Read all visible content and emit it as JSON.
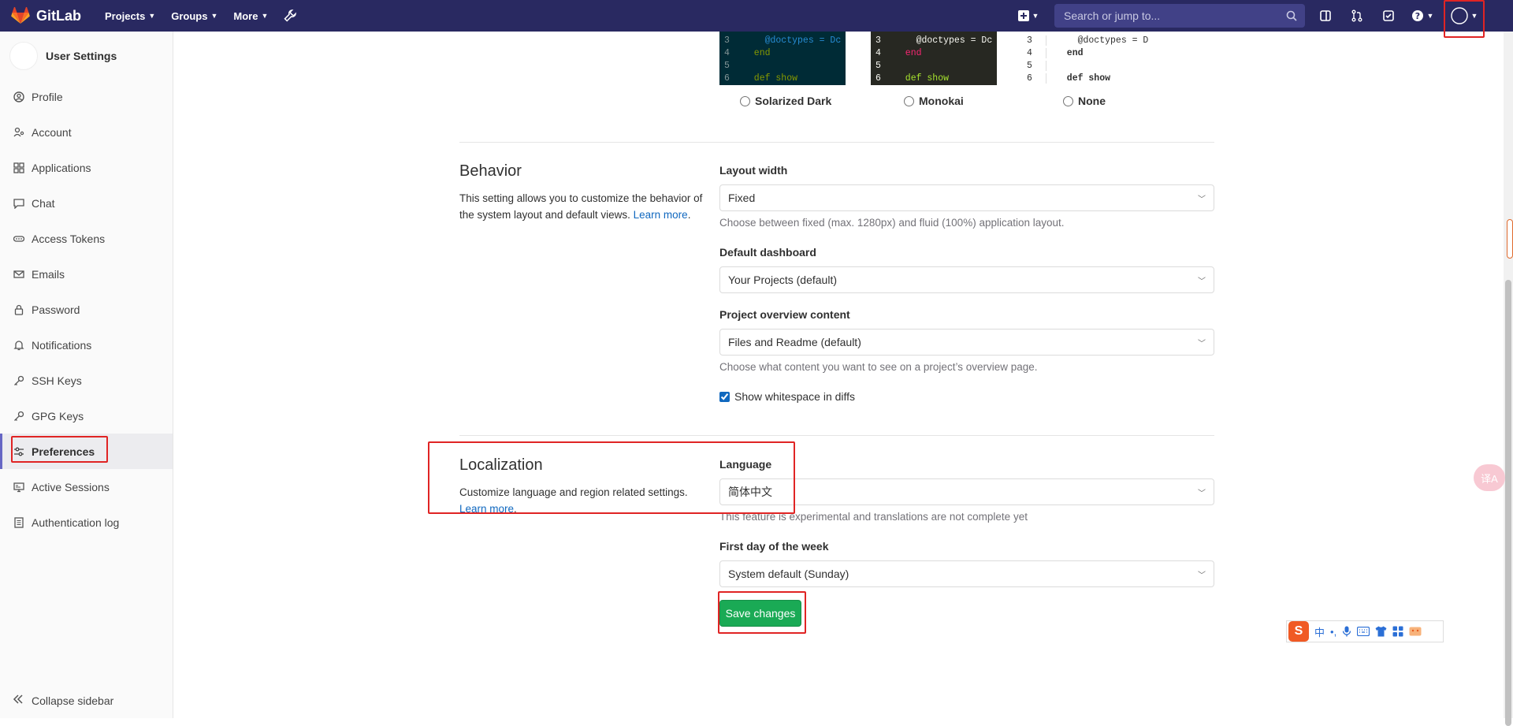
{
  "navbar": {
    "brand": "GitLab",
    "menu": [
      {
        "label": "Projects"
      },
      {
        "label": "Groups"
      },
      {
        "label": "More"
      }
    ],
    "search_placeholder": "Search or jump to..."
  },
  "sidebar": {
    "title": "User Settings",
    "items": [
      {
        "label": "Profile",
        "icon": "profile-icon"
      },
      {
        "label": "Account",
        "icon": "account-icon"
      },
      {
        "label": "Applications",
        "icon": "applications-icon"
      },
      {
        "label": "Chat",
        "icon": "chat-icon"
      },
      {
        "label": "Access Tokens",
        "icon": "token-icon"
      },
      {
        "label": "Emails",
        "icon": "email-icon"
      },
      {
        "label": "Password",
        "icon": "lock-icon"
      },
      {
        "label": "Notifications",
        "icon": "bell-icon"
      },
      {
        "label": "SSH Keys",
        "icon": "key-icon"
      },
      {
        "label": "GPG Keys",
        "icon": "key-icon"
      },
      {
        "label": "Preferences",
        "icon": "preferences-icon",
        "active": true
      },
      {
        "label": "Active Sessions",
        "icon": "monitor-icon"
      },
      {
        "label": "Authentication log",
        "icon": "log-icon"
      }
    ],
    "collapse_label": "Collapse sidebar"
  },
  "themes": [
    {
      "name": "Solarized Dark",
      "lines": [
        {
          "n": "3",
          "code": "    @doctypes = Dc"
        },
        {
          "n": "4",
          "code": "  end"
        },
        {
          "n": "5",
          "code": ""
        },
        {
          "n": "6",
          "code": "  def show"
        }
      ]
    },
    {
      "name": "Monokai",
      "lines": [
        {
          "n": "3",
          "code": "    @doctypes = Dc"
        },
        {
          "n": "4",
          "code": "  end"
        },
        {
          "n": "5",
          "code": ""
        },
        {
          "n": "6",
          "code": "  def show"
        }
      ]
    },
    {
      "name": "None",
      "lines": [
        {
          "n": "3",
          "code": "    @doctypes = Dc"
        },
        {
          "n": "4",
          "code": "  end"
        },
        {
          "n": "5",
          "code": ""
        },
        {
          "n": "6",
          "code": "  def show"
        }
      ]
    }
  ],
  "behavior": {
    "title": "Behavior",
    "description": "This setting allows you to customize the behavior of the system layout and default views.",
    "learn_more": "Learn more",
    "layout_width_label": "Layout width",
    "layout_width_value": "Fixed",
    "layout_width_help": "Choose between fixed (max. 1280px) and fluid (100%) application layout.",
    "dashboard_label": "Default dashboard",
    "dashboard_value": "Your Projects (default)",
    "overview_label": "Project overview content",
    "overview_value": "Files and Readme (default)",
    "overview_help": "Choose what content you want to see on a project’s overview page.",
    "whitespace_label": "Show whitespace in diffs"
  },
  "localization": {
    "title": "Localization",
    "description": "Customize language and region related settings.",
    "learn_more": "Learn more",
    "language_label": "Language",
    "language_value": "简体中文",
    "language_help": "This feature is experimental and translations are not complete yet",
    "first_day_label": "First day of the week",
    "first_day_value": "System default (Sunday)"
  },
  "save_label": "Save changes",
  "ime": {
    "lang": "中"
  },
  "translate_fab_label": "译A",
  "colors": {
    "navbar": "#292961",
    "save": "#1aaa55",
    "link": "#1068bf",
    "highlight": "#e02424"
  }
}
